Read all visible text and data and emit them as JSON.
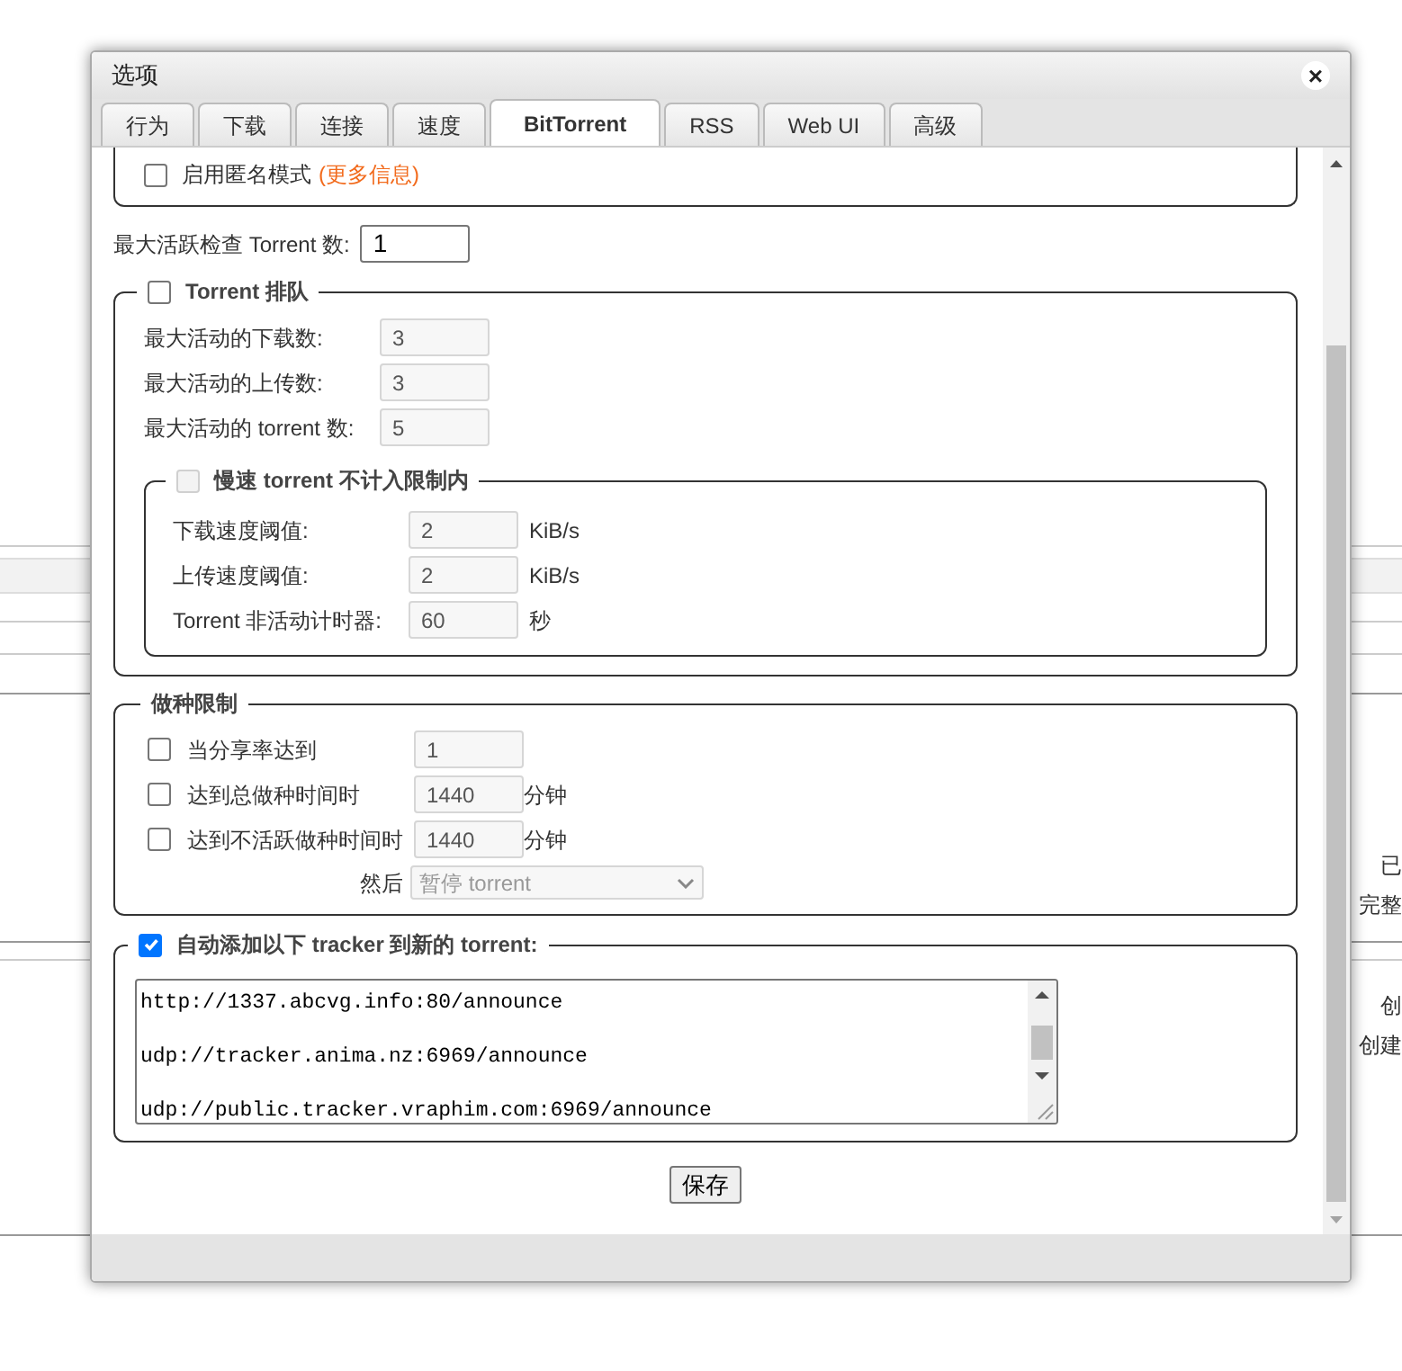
{
  "window": {
    "title": "选项",
    "close": "×"
  },
  "tabs": [
    {
      "label": "行为",
      "selected": false
    },
    {
      "label": "下载",
      "selected": false
    },
    {
      "label": "连接",
      "selected": false
    },
    {
      "label": "速度",
      "selected": false
    },
    {
      "label": "BitTorrent",
      "selected": true
    },
    {
      "label": "RSS",
      "selected": false
    },
    {
      "label": "Web UI",
      "selected": false
    },
    {
      "label": "高级",
      "selected": false
    }
  ],
  "anonymous": {
    "label": "启用匿名模式",
    "link": "(更多信息)",
    "checked": false
  },
  "max_active_checking": {
    "label": "最大活跃检查 Torrent 数:",
    "value": "1"
  },
  "queueing": {
    "label": "Torrent 排队",
    "checked": false,
    "fields": [
      {
        "label": "最大活动的下载数:",
        "value": "3"
      },
      {
        "label": "最大活动的上传数:",
        "value": "3"
      },
      {
        "label": "最大活动的 torrent 数:",
        "value": "5"
      }
    ],
    "slow": {
      "label": "慢速 torrent 不计入限制内",
      "checked": false,
      "fields": [
        {
          "label": "下载速度阈值:",
          "value": "2",
          "unit": "KiB/s"
        },
        {
          "label": "上传速度阈值:",
          "value": "2",
          "unit": "KiB/s"
        },
        {
          "label": "Torrent 非活动计时器:",
          "value": "60",
          "unit": "秒"
        }
      ]
    }
  },
  "seeding": {
    "title": "做种限制",
    "rows": [
      {
        "label": "当分享率达到",
        "checked": false,
        "value": "1"
      },
      {
        "label": "达到总做种时间时",
        "checked": false,
        "value": "1440",
        "unit": "分钟"
      },
      {
        "label": "达到不活跃做种时间时",
        "checked": false,
        "value": "1440",
        "unit": "分钟"
      }
    ],
    "then": {
      "label": "然后",
      "value": "暂停 torrent"
    }
  },
  "trackers": {
    "label": "自动添加以下 tracker 到新的 torrent:",
    "checked": true,
    "lines": [
      "http://1337.abcvg.info:80/announce",
      "udp://tracker.anima.nz:6969/announce",
      "udp://public.tracker.vraphim.com:6969/announce"
    ]
  },
  "save": "保存",
  "background": {
    "labels": [
      "已",
      "完整",
      "创",
      "创建"
    ]
  }
}
